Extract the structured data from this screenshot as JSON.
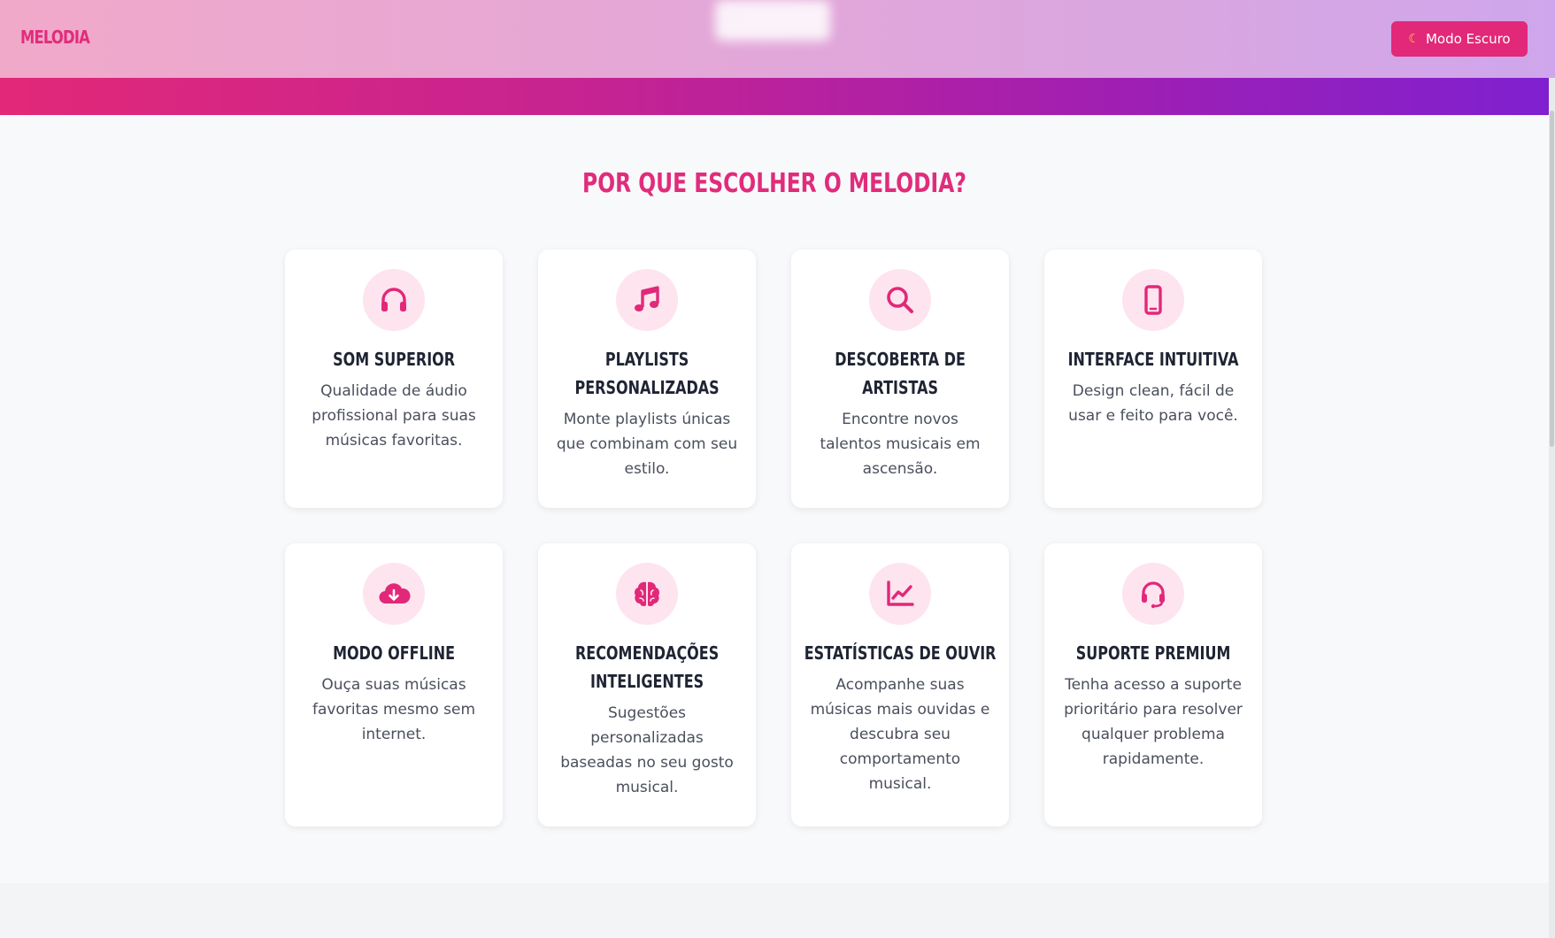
{
  "header": {
    "brand": "MELODIA",
    "mode_button_label": "Modo Escuro",
    "mode_button_icon": "moon-icon"
  },
  "section": {
    "title": "POR QUE ESCOLHER O MELODIA?"
  },
  "features": [
    {
      "icon": "headphones-icon",
      "title": "SOM SUPERIOR",
      "desc": "Qualidade de áudio profissional para suas músicas favoritas."
    },
    {
      "icon": "music-note-icon",
      "title": "PLAYLISTS PERSONALIZADAS",
      "desc": "Monte playlists únicas que combinam com seu estilo."
    },
    {
      "icon": "search-icon",
      "title": "DESCOBERTA DE ARTISTAS",
      "desc": "Encontre novos talentos musicais em ascensão."
    },
    {
      "icon": "mobile-phone-icon",
      "title": "INTERFACE INTUITIVA",
      "desc": "Design clean, fácil de usar e feito para você."
    },
    {
      "icon": "cloud-download-icon",
      "title": "MODO OFFLINE",
      "desc": "Ouça suas músicas favoritas mesmo sem internet."
    },
    {
      "icon": "brain-icon",
      "title": "RECOMENDAÇÕES INTELIGENTES",
      "desc": "Sugestões personalizadas baseadas no seu gosto musical."
    },
    {
      "icon": "chart-line-icon",
      "title": "ESTATÍSTICAS DE OUVIR",
      "desc": "Acompanhe suas músicas mais ouvidas e descubra seu comportamento musical."
    },
    {
      "icon": "headset-icon",
      "title": "SUPORTE PREMIUM",
      "desc": "Tenha acesso a suporte prioritário para resolver qualquer problema rapidamente."
    }
  ],
  "colors": {
    "accent": "#e22878",
    "title_dark": "#1f2433",
    "icon_bg": "#fde4ef",
    "band_start": "#e22878",
    "band_end": "#7f20d0"
  }
}
